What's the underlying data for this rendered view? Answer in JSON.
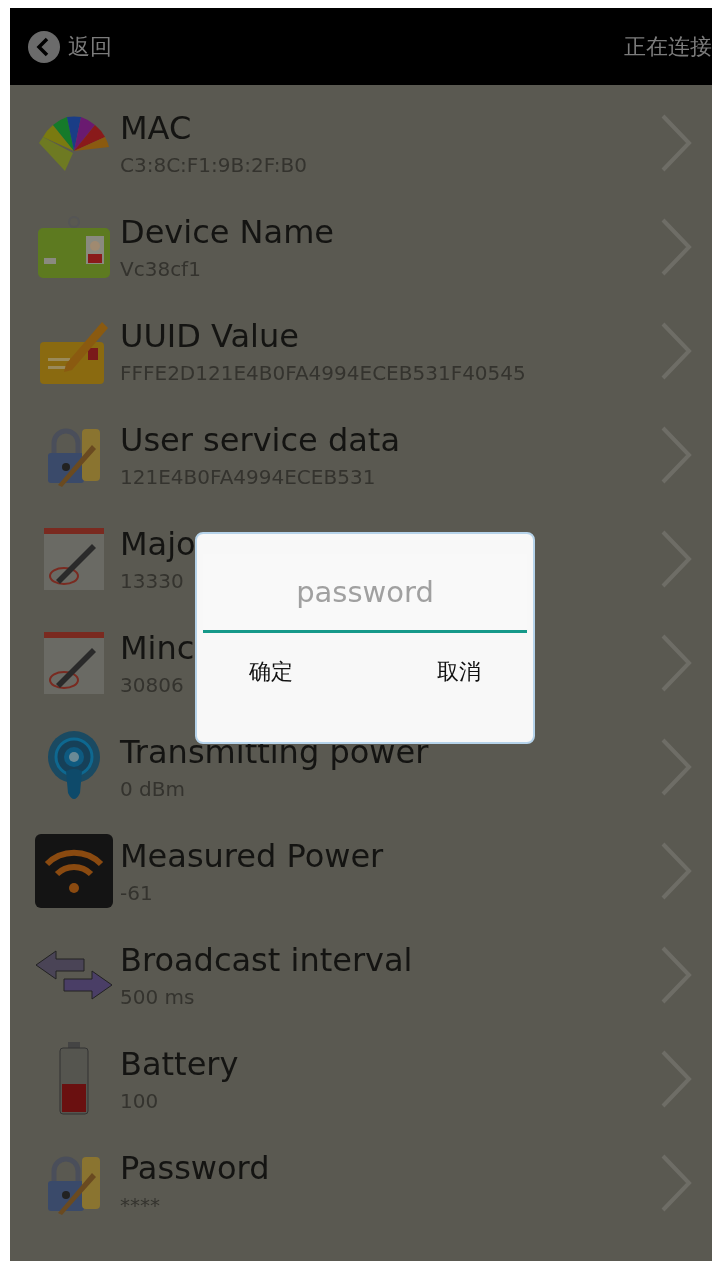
{
  "header": {
    "back_label": "返回",
    "title": "正在连接"
  },
  "rows": [
    {
      "kind": "fan",
      "title": "MAC",
      "value": "C3:8C:F1:9B:2F:B0"
    },
    {
      "kind": "badge",
      "title": "Device Name",
      "value": "Vc38cf1"
    },
    {
      "kind": "envelope",
      "title": "UUID Value",
      "value": "FFFE2D121E4B0FA4994ECEB531F40545"
    },
    {
      "kind": "lock",
      "title": "User service data",
      "value": "121E4B0FA4994ECEB531"
    },
    {
      "kind": "calendar",
      "title": "Majo",
      "value": "13330"
    },
    {
      "kind": "calendar",
      "title": "Minc",
      "value": "30806"
    },
    {
      "kind": "signal",
      "title": "Transmitting power",
      "value": "0 dBm"
    },
    {
      "kind": "wifi",
      "title": "Measured Power",
      "value": "-61"
    },
    {
      "kind": "arrows",
      "title": "Broadcast interval",
      "value": "500 ms"
    },
    {
      "kind": "battery",
      "title": "Battery",
      "value": "100"
    },
    {
      "kind": "lock",
      "title": "Password",
      "value": "****"
    }
  ],
  "dialog": {
    "placeholder": "password",
    "buttons": [
      "确定",
      "取消"
    ]
  }
}
